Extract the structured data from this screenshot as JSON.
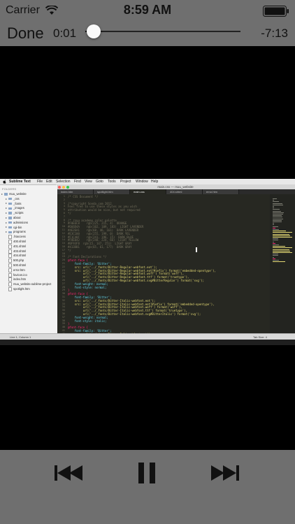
{
  "status_bar": {
    "carrier": "Carrier",
    "time": "8:59 AM"
  },
  "player": {
    "done_label": "Done",
    "elapsed": "0:01",
    "remaining": "-7:13",
    "progress_fraction": 0.01
  },
  "video": {
    "menu_bar": {
      "app": "Sublime Text",
      "items": [
        "File",
        "Edit",
        "Selection",
        "Find",
        "View",
        "Goto",
        "Tools",
        "Project",
        "Window",
        "Help"
      ]
    },
    "window_title": "main.css — rsuu_website",
    "sidebar": {
      "header": "FOLDERS",
      "items": [
        "rsuu_website",
        "_css",
        "_fonts",
        "_images",
        "_scripts",
        "about",
        "admissions",
        "cgi-bin",
        "programs",
        ".htaccess",
        "400.shtml",
        "401.shtml",
        "403.shtml",
        "404.shtml",
        "500.php",
        "500.shtml",
        "error.htm",
        "favicon.ico",
        "index.htm",
        "rsuu_website.sublime-project",
        "spotlight.htm"
      ]
    },
    "tabs": [
      "index.htm",
      "spotlight.htm",
      "main.css",
      "404.shtml",
      "error.htm"
    ],
    "active_tab_index": 2,
    "code_lines": [
      "/* CSS Document */",
      "",
      "/*copyright Sonda.com 2012",
      "Feel free to use these styles as you wish",
      "attribution would be nice, but not required",
      "*/",
      "",
      "/* rsuu academy color palette",
      "#F0E6C8    rgb(225, 215, 4)  ORANGE",
      "#666D4A    rgb(102, 109, 183)  LIGHT LAVENDER",
      "#4E2EA1    rgb(68, 46, 161)  DARK LAVENDER",
      "#E3C100    rgb(255, 199, 0)  DARK YEL",
      "#F1C40F    rgb(241, 196, 15)  DARK BLUE",
      "#F8E042    rgb(248, 224, 66)  LIGHT YELLOW",
      "#0F93FB  rgb(15, 147, 251)  LIGHT GRAY",
      "#413DB1    rgb(65, 61, 177)  DARK GRAY",
      "*/",
      "",
      "/* Font Declarations */",
      "@font-face {",
      "    font-family: 'Bitter';",
      "    src: url('../_fonts/Bitter-Regular-webfont.eot');",
      "    src: url('../_fonts/Bitter-Regular-webfont.eot?#iefix') format('embedded-opentype'),",
      "         url('../_fonts/Bitter-Regular-webfont.woff') format('woff'),",
      "         url('../_fonts/Bitter-Regular-webfont.ttf') format('truetype'),",
      "         url('../_fonts/Bitter-Regular-webfont.svg#BitterRegular') format('svg');",
      "    font-weight: normal;",
      "    font-style: normal;",
      "}",
      "@font-face {",
      "    font-family: 'Bitter';",
      "    src: url('../_fonts/Bitter-Italic-webfont.eot');",
      "    src: url('../_fonts/Bitter-Italic-webfont.eot?#iefix') format('embedded-opentype'),",
      "         url('../_fonts/Bitter-Italic-webfont.woff') format('woff'),",
      "         url('../_fonts/Bitter-Italic-webfont.ttf') format('truetype'),",
      "         url('../_fonts/Bitter-Italic-webfont.svg#BitterItalic') format('svg');",
      "    font-weight: normal;",
      "    font-style: italic;",
      "}",
      "@font-face {",
      "    font-family: 'Bitter';",
      "    src: url('../_fonts/Bitter-Bold-webfont.eot');"
    ],
    "status_left": "Line 1, Column 1",
    "status_right": "Tab Size: 4"
  },
  "colors": {
    "chrome_gray": "#6f6f6f",
    "editor_bg": "#272822",
    "keyword": "#f92672",
    "string": "#e6db74",
    "comment": "#75715e",
    "property": "#66d9ef"
  },
  "controls": {
    "rewind_icon": "skip-back-icon",
    "pause_icon": "pause-icon",
    "forward_icon": "skip-forward-icon"
  }
}
